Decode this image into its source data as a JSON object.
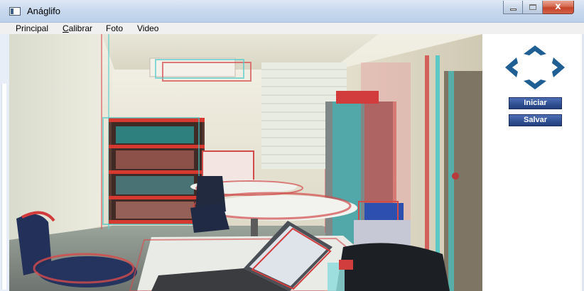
{
  "window": {
    "title": "Anáglifo",
    "close_glyph": "x"
  },
  "menu": [
    {
      "pre": "",
      "u": "",
      "rest": "Principal"
    },
    {
      "pre": "",
      "u": "C",
      "rest": "alibrar"
    },
    {
      "pre": "",
      "u": "",
      "rest": "Foto"
    },
    {
      "pre": "",
      "u": "",
      "rest": "Video"
    }
  ],
  "side": {
    "nav_icon": "four-arrows-nav-icon",
    "start_label": "Iniciar",
    "save_label": "Salvar"
  },
  "colors": {
    "button_blue": "#2f4f93",
    "arrow_blue": "#1f5f94",
    "titlebar": "#c9d9ee",
    "close_red": "#c5432a"
  }
}
